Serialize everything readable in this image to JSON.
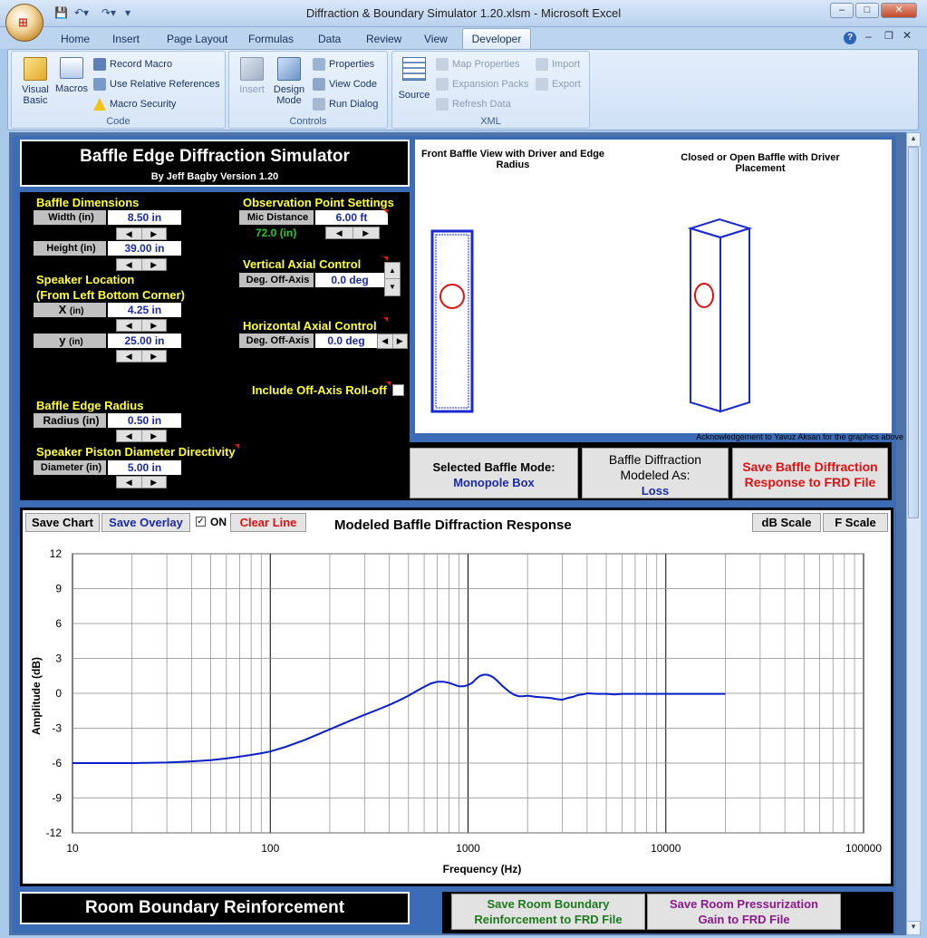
{
  "window": {
    "title": "Diffraction & Boundary Simulator 1.20.xlsm - Microsoft Excel",
    "controls": {
      "minimize": "–",
      "maximize": "□",
      "close": "✕"
    }
  },
  "ribbon": {
    "tabs": [
      "Home",
      "Insert",
      "Page Layout",
      "Formulas",
      "Data",
      "Review",
      "View"
    ],
    "active_tab": "Developer",
    "code_group": {
      "label": "Code",
      "visual_basic": "Visual Basic",
      "macros": "Macros",
      "record_macro": "Record Macro",
      "relative_refs": "Use Relative References",
      "macro_security": "Macro Security"
    },
    "controls_group": {
      "label": "Controls",
      "insert": "Insert",
      "design_mode": "Design Mode",
      "properties": "Properties",
      "view_code": "View Code",
      "run_dialog": "Run Dialog"
    },
    "xml_group": {
      "label": "XML",
      "source": "Source",
      "map_properties": "Map Properties",
      "expansion_packs": "Expansion Packs",
      "refresh_data": "Refresh Data",
      "import": "Import",
      "export": "Export"
    }
  },
  "header": {
    "title": "Baffle Edge Diffraction Simulator",
    "subtitle": "By Jeff Bagby Version 1.20"
  },
  "baffle": {
    "heading": "Baffle Dimensions",
    "width_label": "Width (in)",
    "width_value": "8.50 in",
    "height_label": "Height (in)",
    "height_value": "39.00 in"
  },
  "speaker_location": {
    "heading1": "Speaker Location",
    "heading2": "(From Left Bottom Corner)",
    "x_label": "X",
    "x_unit": "(in)",
    "x_value": "4.25 in",
    "y_label": "y",
    "y_unit": "(in)",
    "y_value": "25.00 in"
  },
  "edge_radius": {
    "heading": "Baffle Edge Radius",
    "label": "Radius (in)",
    "value": "0.50 in"
  },
  "piston": {
    "heading": "Speaker Piston Diameter Directivity",
    "label": "Diameter (in)",
    "value": "5.00 in"
  },
  "observation": {
    "heading": "Observation Point Settings",
    "mic_label": "Mic Distance",
    "mic_value": "6.00 ft",
    "mic_inches": "72.0 (in)"
  },
  "vertical": {
    "heading": "Vertical Axial Control",
    "label": "Deg. Off-Axis",
    "value": "0.0 deg"
  },
  "horizontal": {
    "heading": "Horizontal Axial Control",
    "label": "Deg. Off-Axis",
    "value": "0.0 deg"
  },
  "rolloff": {
    "label": "Include Off-Axis Roll-off",
    "checked": false
  },
  "spinner": {
    "left": "◀",
    "right": "▶",
    "up": "▲",
    "down": "▼"
  },
  "graphics": {
    "front_caption": "Front Baffle View with Driver and Edge Radius",
    "box_caption": "Closed or Open Baffle with Driver Placement",
    "acknowledgement": "Acknowledgement to Yavuz Aksan for the graphics above"
  },
  "mode": {
    "selected_label": "Selected Baffle Mode:",
    "selected_value": "Monopole Box",
    "modeled_label1": "Baffle Diffraction",
    "modeled_label2": "Modeled As:",
    "modeled_value": "Loss",
    "save_line1": "Save Baffle Diffraction",
    "save_line2": "Response to FRD File"
  },
  "chart_controls": {
    "save_chart": "Save Chart",
    "save_overlay": "Save Overlay",
    "on_label": "ON",
    "on_checked": true,
    "clear_line": "Clear Line",
    "db_scale": "dB Scale",
    "f_scale": "F Scale"
  },
  "chart_data": {
    "type": "line",
    "title": "Modeled Baffle Diffraction Response",
    "xlabel": "Frequency (Hz)",
    "ylabel": "Amplitude (dB)",
    "xscale": "log",
    "xlim": [
      10,
      100000
    ],
    "ylim": [
      -12,
      12
    ],
    "xticks": [
      "10",
      "100",
      "1000",
      "10000",
      "100000"
    ],
    "yticks": [
      "12",
      "9",
      "6",
      "3",
      "0",
      "-3",
      "-6",
      "-9",
      "-12"
    ],
    "grid": true,
    "series": [
      {
        "color": "#0a1ec8",
        "x": [
          10,
          20,
          30,
          40,
          50,
          60,
          70,
          80,
          90,
          100,
          120,
          150,
          200,
          250,
          300,
          350,
          400,
          450,
          500,
          550,
          600,
          650,
          700,
          750,
          800,
          850,
          900,
          950,
          1000,
          1050,
          1100,
          1150,
          1200,
          1250,
          1300,
          1350,
          1400,
          1500,
          1600,
          1700,
          1800,
          1900,
          2000,
          2100,
          2200,
          2400,
          2600,
          2800,
          3000,
          3200,
          3400,
          3600,
          3800,
          4000,
          4500,
          5000,
          5500,
          6000,
          7000,
          8000,
          10000,
          12000,
          15000,
          20000
        ],
        "y": [
          -6.0,
          -6.0,
          -5.95,
          -5.85,
          -5.75,
          -5.6,
          -5.45,
          -5.3,
          -5.15,
          -5.0,
          -4.6,
          -4.0,
          -3.1,
          -2.4,
          -1.85,
          -1.4,
          -1.0,
          -0.6,
          -0.2,
          0.2,
          0.55,
          0.85,
          1.0,
          1.0,
          0.9,
          0.75,
          0.6,
          0.6,
          0.7,
          0.9,
          1.25,
          1.5,
          1.6,
          1.6,
          1.5,
          1.35,
          1.1,
          0.6,
          0.2,
          -0.1,
          -0.25,
          -0.25,
          -0.2,
          -0.25,
          -0.3,
          -0.35,
          -0.4,
          -0.5,
          -0.55,
          -0.4,
          -0.3,
          -0.15,
          -0.1,
          0.0,
          -0.05,
          -0.05,
          -0.1,
          -0.05,
          -0.05,
          -0.05,
          -0.05,
          -0.05,
          -0.05,
          -0.05
        ]
      }
    ]
  },
  "room": {
    "title": "Room Boundary Reinforcement",
    "save_reinf_line1": "Save Room Boundary",
    "save_reinf_line2": "Reinforcement to FRD File",
    "save_press_line1": "Save Room Pressurization",
    "save_press_line2": "Gain to FRD File"
  },
  "colors": {
    "accent_yellow": "#ffff33",
    "value_blue": "#1a2aa6",
    "alert_red": "#dd1111",
    "green": "#1c7a1c",
    "purple": "#8a1a8a"
  }
}
